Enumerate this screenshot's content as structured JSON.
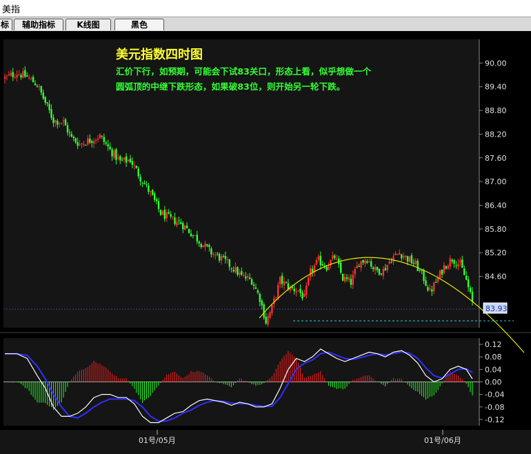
{
  "window": {
    "title": "美指"
  },
  "tabs": [
    {
      "label": "标"
    },
    {
      "label": "辅助指标"
    },
    {
      "label": "K线图"
    },
    {
      "label": "黑色"
    }
  ],
  "colors": {
    "background": "#000000",
    "panel": "#151515",
    "up_candle": "#ff3030",
    "down_candle": "#33ff33",
    "axis_text": "#e0e0e0",
    "title": "#ffff33",
    "annotation": "#33ff33",
    "arc": "#e8e800",
    "price_box": "#c8d8ff",
    "macd_pos": "#ff2020",
    "macd_neg": "#20ff20",
    "dif_line": "#ffffff",
    "dea_line": "#3030ff"
  },
  "chart_data": [
    {
      "type": "candlestick",
      "title": "美元指数四时图",
      "subtitle": "汇价下行，如预期，可能会下试83关口，形态上看，似乎想做一个圆弧顶的中继下跌形态，如果破83位，则开始另一轮下跌。",
      "subtitle_lines": [
        "汇价下行，如预期，可能会下试83关口，形态上看，似乎想做一个",
        "圆弧顶的中继下跌形态，如果破83位，则开始另一轮下跌。"
      ],
      "ylim": [
        83.3,
        90.6
      ],
      "y_ticks": [
        "90.00",
        "89.40",
        "88.80",
        "88.20",
        "87.60",
        "87.00",
        "86.40",
        "85.80",
        "85.20",
        "84.60"
      ],
      "last_price": "83.93",
      "x_tick_labels": [
        "01号/05月",
        "01号/06月"
      ],
      "close_path": [
        [
          0,
          89.62
        ],
        [
          12,
          89.75
        ],
        [
          22,
          89.65
        ],
        [
          32,
          89.45
        ],
        [
          40,
          89.0
        ],
        [
          48,
          88.55
        ],
        [
          58,
          88.5
        ],
        [
          66,
          88.1
        ],
        [
          74,
          87.95
        ],
        [
          84,
          88.05
        ],
        [
          94,
          88.15
        ],
        [
          104,
          87.8
        ],
        [
          114,
          87.5
        ],
        [
          124,
          87.55
        ],
        [
          134,
          87.1
        ],
        [
          144,
          86.7
        ],
        [
          154,
          86.2
        ],
        [
          164,
          86.05
        ],
        [
          174,
          85.95
        ],
        [
          184,
          85.7
        ],
        [
          194,
          85.45
        ],
        [
          204,
          85.2
        ],
        [
          214,
          85.05
        ],
        [
          224,
          84.85
        ],
        [
          234,
          84.6
        ],
        [
          244,
          84.5
        ],
        [
          252,
          84.05
        ],
        [
          258,
          83.45
        ],
        [
          264,
          83.8
        ],
        [
          272,
          84.5
        ],
        [
          282,
          84.3
        ],
        [
          290,
          84.25
        ],
        [
          296,
          84.05
        ],
        [
          302,
          84.7
        ],
        [
          310,
          85.0
        ],
        [
          318,
          84.85
        ],
        [
          326,
          85.1
        ],
        [
          334,
          84.55
        ],
        [
          342,
          84.45
        ],
        [
          350,
          84.95
        ],
        [
          358,
          85.05
        ],
        [
          366,
          84.75
        ],
        [
          374,
          84.75
        ],
        [
          382,
          85.05
        ],
        [
          390,
          85.2
        ],
        [
          398,
          85.05
        ],
        [
          406,
          84.9
        ],
        [
          414,
          84.55
        ],
        [
          420,
          84.2
        ],
        [
          426,
          84.45
        ],
        [
          434,
          84.85
        ],
        [
          442,
          85.05
        ],
        [
          450,
          84.9
        ],
        [
          456,
          84.5
        ],
        [
          462,
          83.93
        ]
      ],
      "arc_reference": {
        "label": "圆弧顶"
      },
      "support_level": 83.3
    },
    {
      "type": "macd",
      "ylim": [
        -0.14,
        0.14
      ],
      "y_ticks": [
        "0.12",
        "0.08",
        "0.04",
        "0.00",
        "-0.04",
        "-0.08",
        "-0.12"
      ],
      "dif": [
        [
          0,
          0.09
        ],
        [
          12,
          0.09
        ],
        [
          22,
          0.075
        ],
        [
          32,
          0.02
        ],
        [
          40,
          -0.02
        ],
        [
          48,
          -0.08
        ],
        [
          56,
          -0.11
        ],
        [
          64,
          -0.11
        ],
        [
          72,
          -0.1
        ],
        [
          80,
          -0.08
        ],
        [
          88,
          -0.05
        ],
        [
          96,
          -0.04
        ],
        [
          104,
          -0.04
        ],
        [
          112,
          -0.05
        ],
        [
          120,
          -0.05
        ],
        [
          128,
          -0.07
        ],
        [
          136,
          -0.11
        ],
        [
          144,
          -0.13
        ],
        [
          152,
          -0.13
        ],
        [
          160,
          -0.115
        ],
        [
          168,
          -0.1
        ],
        [
          176,
          -0.095
        ],
        [
          184,
          -0.075
        ],
        [
          192,
          -0.06
        ],
        [
          200,
          -0.055
        ],
        [
          208,
          -0.06
        ],
        [
          216,
          -0.065
        ],
        [
          224,
          -0.075
        ],
        [
          232,
          -0.065
        ],
        [
          240,
          -0.07
        ],
        [
          248,
          -0.08
        ],
        [
          256,
          -0.08
        ],
        [
          264,
          -0.07
        ],
        [
          272,
          -0.02
        ],
        [
          280,
          0.04
        ],
        [
          288,
          0.075
        ],
        [
          296,
          0.065
        ],
        [
          304,
          0.08
        ],
        [
          312,
          0.105
        ],
        [
          320,
          0.09
        ],
        [
          328,
          0.075
        ],
        [
          336,
          0.065
        ],
        [
          344,
          0.075
        ],
        [
          352,
          0.085
        ],
        [
          360,
          0.095
        ],
        [
          368,
          0.09
        ],
        [
          376,
          0.08
        ],
        [
          384,
          0.095
        ],
        [
          392,
          0.1
        ],
        [
          400,
          0.085
        ],
        [
          408,
          0.06
        ],
        [
          416,
          0.02
        ],
        [
          424,
          0.0
        ],
        [
          432,
          0.01
        ],
        [
          440,
          0.04
        ],
        [
          448,
          0.05
        ],
        [
          456,
          0.04
        ],
        [
          462,
          0.01
        ]
      ],
      "dea": [
        [
          0,
          0.09
        ],
        [
          12,
          0.09
        ],
        [
          22,
          0.085
        ],
        [
          32,
          0.05
        ],
        [
          40,
          0.01
        ],
        [
          48,
          -0.04
        ],
        [
          56,
          -0.08
        ],
        [
          64,
          -0.11
        ],
        [
          72,
          -0.115
        ],
        [
          80,
          -0.1
        ],
        [
          88,
          -0.08
        ],
        [
          96,
          -0.065
        ],
        [
          104,
          -0.055
        ],
        [
          112,
          -0.055
        ],
        [
          120,
          -0.055
        ],
        [
          128,
          -0.06
        ],
        [
          136,
          -0.08
        ],
        [
          144,
          -0.11
        ],
        [
          152,
          -0.125
        ],
        [
          160,
          -0.125
        ],
        [
          168,
          -0.115
        ],
        [
          176,
          -0.1
        ],
        [
          184,
          -0.09
        ],
        [
          192,
          -0.075
        ],
        [
          200,
          -0.065
        ],
        [
          208,
          -0.06
        ],
        [
          216,
          -0.062
        ],
        [
          224,
          -0.068
        ],
        [
          232,
          -0.07
        ],
        [
          240,
          -0.07
        ],
        [
          248,
          -0.075
        ],
        [
          256,
          -0.078
        ],
        [
          264,
          -0.078
        ],
        [
          272,
          -0.05
        ],
        [
          280,
          -0.005
        ],
        [
          288,
          0.04
        ],
        [
          296,
          0.06
        ],
        [
          304,
          0.07
        ],
        [
          312,
          0.09
        ],
        [
          320,
          0.095
        ],
        [
          328,
          0.085
        ],
        [
          336,
          0.075
        ],
        [
          344,
          0.072
        ],
        [
          352,
          0.078
        ],
        [
          360,
          0.085
        ],
        [
          368,
          0.09
        ],
        [
          376,
          0.086
        ],
        [
          384,
          0.09
        ],
        [
          392,
          0.096
        ],
        [
          400,
          0.092
        ],
        [
          408,
          0.075
        ],
        [
          416,
          0.045
        ],
        [
          424,
          0.02
        ],
        [
          432,
          0.012
        ],
        [
          440,
          0.025
        ],
        [
          448,
          0.04
        ],
        [
          456,
          0.042
        ],
        [
          462,
          0.03
        ]
      ]
    }
  ]
}
